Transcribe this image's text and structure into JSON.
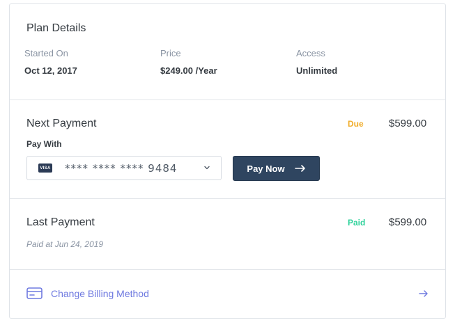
{
  "plan": {
    "title": "Plan Details",
    "started_on_label": "Started On",
    "started_on_value": "Oct 12, 2017",
    "price_label": "Price",
    "price_value": "$249.00 /Year",
    "access_label": "Access",
    "access_value": "Unlimited"
  },
  "next_payment": {
    "title": "Next Payment",
    "status": "Due",
    "amount": "$599.00",
    "pay_with_label": "Pay With",
    "card_brand": "VISA",
    "card_number": "**** **** **** 9484",
    "pay_button": "Pay Now"
  },
  "last_payment": {
    "title": "Last Payment",
    "status": "Paid",
    "amount": "$599.00",
    "paid_at": "Paid at Jun 24, 2019"
  },
  "billing": {
    "link_label": "Change Billing Method"
  },
  "colors": {
    "accent": "#6f7ae0",
    "due": "#f0ad2b",
    "paid": "#2fd29b",
    "button_bg": "#2f4560"
  },
  "icons": {
    "card_brand": "visa-icon",
    "dropdown": "chevron-down-icon",
    "pay_arrow": "arrow-right-icon",
    "billing": "credit-card-icon",
    "billing_arrow": "arrow-right-icon"
  }
}
